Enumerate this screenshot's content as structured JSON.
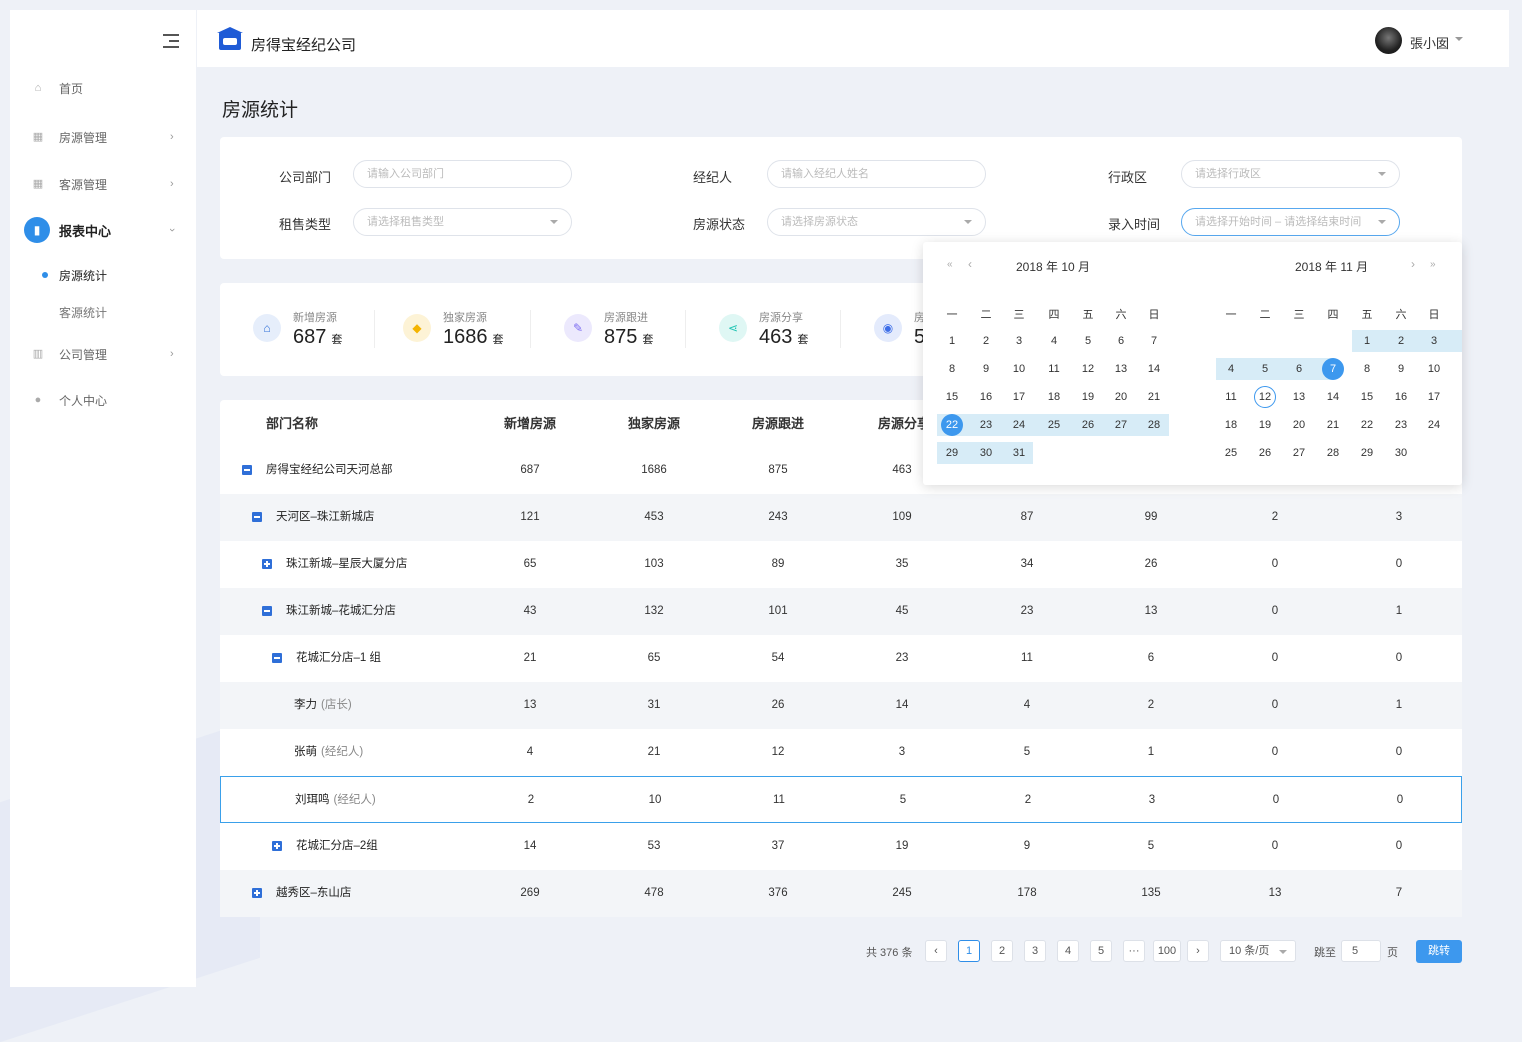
{
  "header": {
    "company": "房得宝经纪公司",
    "username": "張小囡"
  },
  "sidebar": {
    "items": [
      {
        "label": "首页",
        "icon": "home-icon"
      },
      {
        "label": "房源管理",
        "icon": "building-icon"
      },
      {
        "label": "客源管理",
        "icon": "customer-icon"
      },
      {
        "label": "报表中心",
        "icon": "chart-icon"
      },
      {
        "label": "公司管理",
        "icon": "company-icon"
      },
      {
        "label": "个人中心",
        "icon": "user-icon"
      }
    ],
    "sub_items": [
      {
        "label": "房源统计"
      },
      {
        "label": "客源统计"
      }
    ]
  },
  "page": {
    "title": "房源统计"
  },
  "filters": {
    "dept_label": "公司部门",
    "dept_placeholder": "请输入公司部门",
    "agent_label": "经纪人",
    "agent_placeholder": "请输入经纪人姓名",
    "district_label": "行政区",
    "district_placeholder": "请选择行政区",
    "type_label": "租售类型",
    "type_placeholder": "请选择租售类型",
    "status_label": "房源状态",
    "status_placeholder": "请选择房源状态",
    "time_label": "录入时间",
    "time_placeholder": "请选择开始时间 – 请选择结束时间"
  },
  "stats": [
    {
      "label": "新增房源",
      "value": "687",
      "unit": "套",
      "icon": "home-icon",
      "color": "#2f6fd8"
    },
    {
      "label": "独家房源",
      "value": "1686",
      "unit": "套",
      "icon": "diamond-icon",
      "color": "#f4b400"
    },
    {
      "label": "房源跟进",
      "value": "875",
      "unit": "套",
      "icon": "edit-icon",
      "color": "#7c6cf0"
    },
    {
      "label": "房源分享",
      "value": "463",
      "unit": "套",
      "icon": "share-icon",
      "color": "#26c6b5"
    },
    {
      "label": "房",
      "value": "5",
      "unit": "",
      "icon": "eye-icon",
      "color": "#3d6ee8"
    }
  ],
  "table": {
    "headers": [
      "部门名称",
      "新增房源",
      "独家房源",
      "房源跟进",
      "房源分享"
    ],
    "rows": [
      {
        "name": "房得宝经纪公司天河总部",
        "role": "",
        "vals": [
          "687",
          "1686",
          "875",
          "463",
          "",
          "",
          "",
          ""
        ],
        "toggle": "minus",
        "level": 0
      },
      {
        "name": "天河区–珠江新城店",
        "role": "",
        "vals": [
          "121",
          "453",
          "243",
          "109",
          "87",
          "99",
          "2",
          "3"
        ],
        "toggle": "minus",
        "level": 1
      },
      {
        "name": "珠江新城–星辰大厦分店",
        "role": "",
        "vals": [
          "65",
          "103",
          "89",
          "35",
          "34",
          "26",
          "0",
          "0"
        ],
        "toggle": "plus",
        "level": 2
      },
      {
        "name": "珠江新城–花城汇分店",
        "role": "",
        "vals": [
          "43",
          "132",
          "101",
          "45",
          "23",
          "13",
          "0",
          "1"
        ],
        "toggle": "minus",
        "level": 2
      },
      {
        "name": "花城汇分店–1 组",
        "role": "",
        "vals": [
          "21",
          "65",
          "54",
          "23",
          "11",
          "6",
          "0",
          "0"
        ],
        "toggle": "minus",
        "level": 3
      },
      {
        "name": "李力",
        "role": "(店长)",
        "vals": [
          "13",
          "31",
          "26",
          "14",
          "4",
          "2",
          "0",
          "1"
        ],
        "toggle": "",
        "level": 3
      },
      {
        "name": "张萌",
        "role": "(经纪人)",
        "vals": [
          "4",
          "21",
          "12",
          "3",
          "5",
          "1",
          "0",
          "0"
        ],
        "toggle": "",
        "level": 3
      },
      {
        "name": "刘珥鸣",
        "role": "(经纪人)",
        "vals": [
          "2",
          "10",
          "11",
          "5",
          "2",
          "3",
          "0",
          "0"
        ],
        "toggle": "",
        "level": 3
      },
      {
        "name": "花城汇分店–2组",
        "role": "",
        "vals": [
          "14",
          "53",
          "37",
          "19",
          "9",
          "5",
          "0",
          "0"
        ],
        "toggle": "plus",
        "level": 3
      },
      {
        "name": "越秀区–东山店",
        "role": "",
        "vals": [
          "269",
          "478",
          "376",
          "245",
          "178",
          "135",
          "13",
          "7"
        ],
        "toggle": "plus",
        "level": 1
      }
    ]
  },
  "pagination": {
    "total": "共 376 条",
    "pages": [
      "1",
      "2",
      "3",
      "4",
      "5",
      "···",
      "100"
    ],
    "current": "1",
    "page_size": "10 条/页",
    "jump_label": "跳至",
    "jump_value": "5",
    "page_unit": "页",
    "jump_button": "跳转",
    "prev": "‹",
    "next": "›"
  },
  "calendar": {
    "left_title": "2018 年 10 月",
    "right_title": "2018 年 11 月",
    "weekdays": [
      "一",
      "二",
      "三",
      "四",
      "五",
      "六",
      "日"
    ],
    "left_days": [
      [
        "1",
        "2",
        "3",
        "4",
        "5",
        "6",
        "7"
      ],
      [
        "8",
        "9",
        "10",
        "11",
        "12",
        "13",
        "14"
      ],
      [
        "15",
        "16",
        "17",
        "18",
        "19",
        "20",
        "21"
      ],
      [
        "22",
        "23",
        "24",
        "25",
        "26",
        "27",
        "28"
      ],
      [
        "29",
        "30",
        "31"
      ]
    ],
    "right_days": [
      [
        "",
        "",
        "",
        "1",
        "2",
        "3"
      ],
      [
        "4",
        "5",
        "6",
        "7",
        "8",
        "9",
        "10"
      ],
      [
        "11",
        "12",
        "13",
        "14",
        "15",
        "16",
        "17"
      ],
      [
        "18",
        "19",
        "20",
        "21",
        "22",
        "23",
        "24"
      ],
      [
        "25",
        "26",
        "27",
        "28",
        "29",
        "30"
      ]
    ],
    "range_start": "22",
    "range_end": "7",
    "today": "12",
    "prev_year": "«",
    "prev_month": "‹",
    "next_month": "›",
    "next_year": "»"
  }
}
